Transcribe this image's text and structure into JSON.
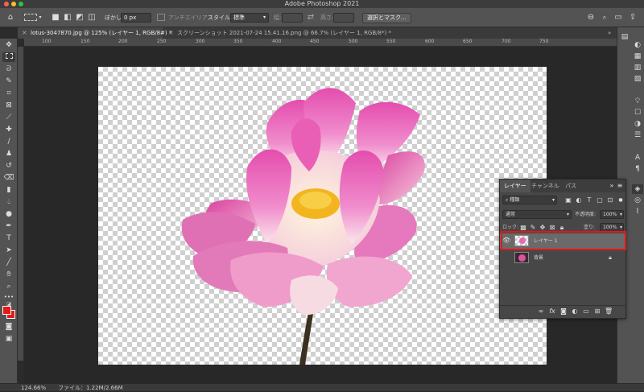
{
  "app": {
    "title": "Adobe Photoshop 2021"
  },
  "window_controls": {
    "close_color": "#ff5f57",
    "minimize_color": "#febc2e",
    "zoom_color": "#28c840"
  },
  "options_bar": {
    "feather_label": "ぼかし:",
    "feather_value": "0 px",
    "antialias_label": "アンチエイリアス",
    "style_label": "スタイル:",
    "style_value": "標準",
    "width_label": "幅:",
    "height_label": "高さ:",
    "select_mask_button": "選択とマスク..."
  },
  "tabs": [
    {
      "label": "lotus-3047870.jpg @ 125% (レイヤー 1, RGB/8#) *",
      "active": true
    },
    {
      "label": "スクリーンショット 2021-07-24 15.41.16.png @ 66.7% (レイヤー 1, RGB/8*) *",
      "active": false
    }
  ],
  "ruler": {
    "top": [
      "100",
      "150",
      "200",
      "250",
      "300",
      "350",
      "400",
      "450",
      "500",
      "550",
      "600",
      "650",
      "700",
      "750"
    ]
  },
  "foreground_color": "#e21a1a",
  "background_color": "#e21a1a",
  "layers_panel": {
    "tabs": [
      "レイヤー",
      "チャンネル",
      "パス"
    ],
    "filter_label": "種類",
    "blend_mode": "通常",
    "opacity_label": "不透明度:",
    "opacity_value": "100%",
    "lock_label": "ロック:",
    "fill_label": "塗り:",
    "fill_value": "100%",
    "layers": [
      {
        "name": "レイヤー 1",
        "visible": true,
        "selected": true
      },
      {
        "name": "背景",
        "visible": false,
        "locked": true
      }
    ]
  },
  "highlight_color": "#e01818",
  "status": {
    "zoom": "124.66%",
    "file_info": "ファイル：1.22M/2.66M"
  }
}
